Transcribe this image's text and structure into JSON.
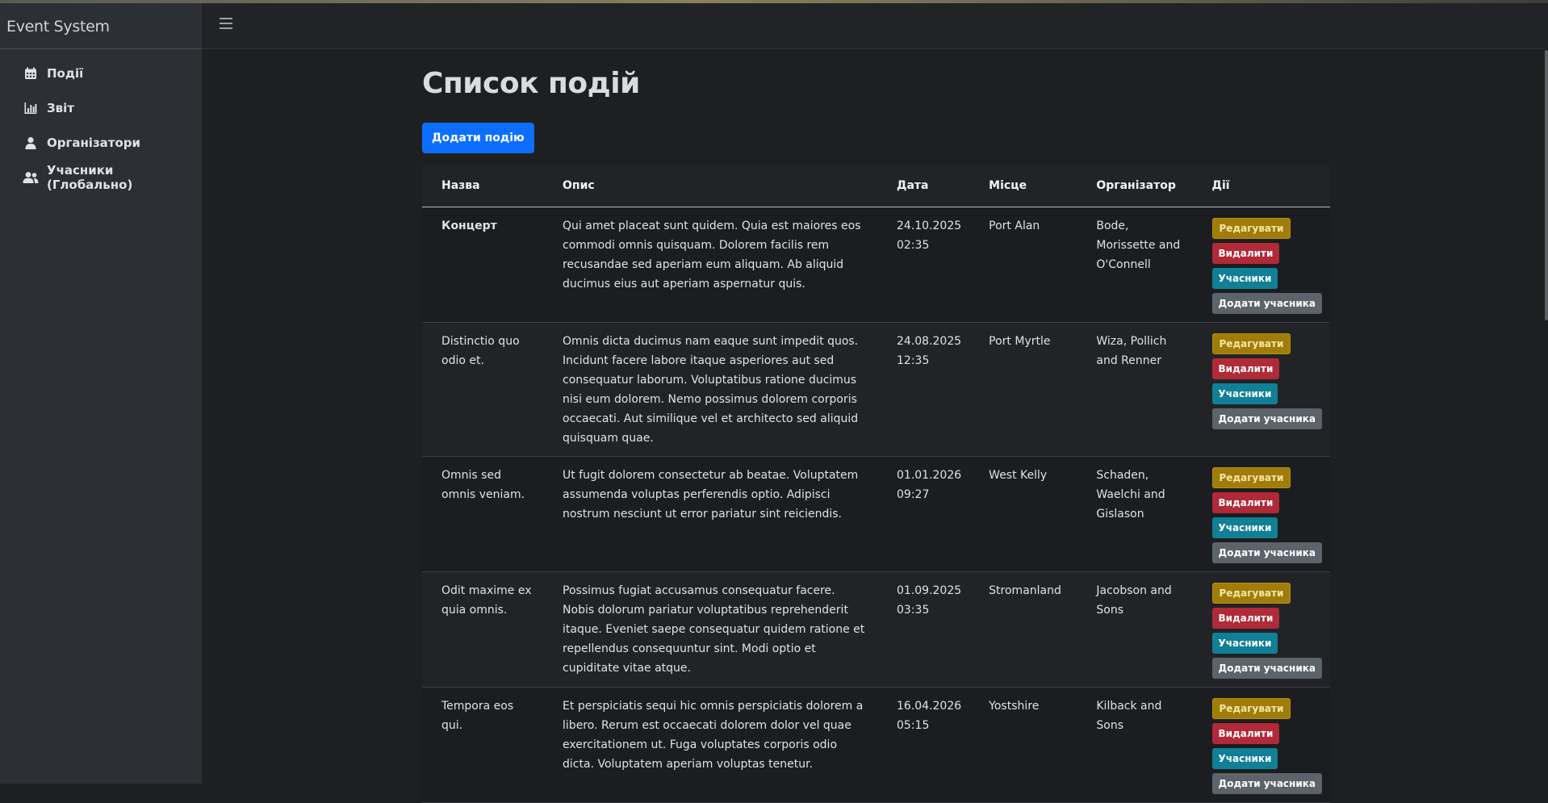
{
  "app": {
    "title": "Event System"
  },
  "sidebar": {
    "items": [
      {
        "label": "Події",
        "icon": "calendar-icon"
      },
      {
        "label": "Звіт",
        "icon": "chart-icon"
      },
      {
        "label": "Організатори",
        "icon": "user-icon"
      },
      {
        "label": "Учасники (Глобально)",
        "icon": "users-icon"
      }
    ]
  },
  "page": {
    "title": "Список подій",
    "add_button": "Додати подію"
  },
  "table": {
    "headers": [
      "Назва",
      "Опис",
      "Дата",
      "Місце",
      "Організатор",
      "Дії"
    ],
    "actions": {
      "edit": "Редагувати",
      "delete": "Видалити",
      "participants": "Учасники",
      "add_participant": "Додати учасника"
    },
    "rows": [
      {
        "name": "Концерт",
        "description": "Qui amet placeat sunt quidem. Quia est maiores eos commodi omnis quisquam. Dolorem facilis rem recusandae sed aperiam eum aliquam. Ab aliquid ducimus eius aut aperiam aspernatur quis.",
        "date": "24.10.2025",
        "time": "02:35",
        "place": "Port Alan",
        "organizer": "Bode, Morissette and O'Connell"
      },
      {
        "name": "Distinctio quo odio et.",
        "description": "Omnis dicta ducimus nam eaque sunt impedit quos. Incidunt facere labore itaque asperiores aut sed consequatur laborum. Voluptatibus ratione ducimus nisi eum dolorem. Nemo possimus dolorem corporis occaecati. Aut similique vel et architecto sed aliquid quisquam quae.",
        "date": "24.08.2025",
        "time": "12:35",
        "place": "Port Myrtle",
        "organizer": "Wiza, Pollich and Renner"
      },
      {
        "name": "Omnis sed omnis veniam.",
        "description": "Ut fugit dolorem consectetur ab beatae. Voluptatem assumenda voluptas perferendis optio. Adipisci nostrum nesciunt ut error pariatur sint reiciendis.",
        "date": "01.01.2026",
        "time": "09:27",
        "place": "West Kelly",
        "organizer": "Schaden, Waelchi and Gislason"
      },
      {
        "name": "Odit maxime ex quia omnis.",
        "description": "Possimus fugiat accusamus consequatur facere. Nobis dolorum pariatur voluptatibus reprehenderit itaque. Eveniet saepe consequatur quidem ratione et repellendus consequuntur sint. Modi optio et cupiditate vitae atque.",
        "date": "01.09.2025",
        "time": "03:35",
        "place": "Stromanland",
        "organizer": "Jacobson and Sons"
      },
      {
        "name": "Tempora eos qui.",
        "description": "Et perspiciatis sequi hic omnis perspiciatis dolorem a libero. Rerum est occaecati dolorem dolor vel quae exercitationem ut. Fuga voluptates corporis odio dicta. Voluptatem aperiam voluptas tenetur.",
        "date": "16.04.2026",
        "time": "05:15",
        "place": "Yostshire",
        "organizer": "Kilback and Sons"
      }
    ]
  }
}
